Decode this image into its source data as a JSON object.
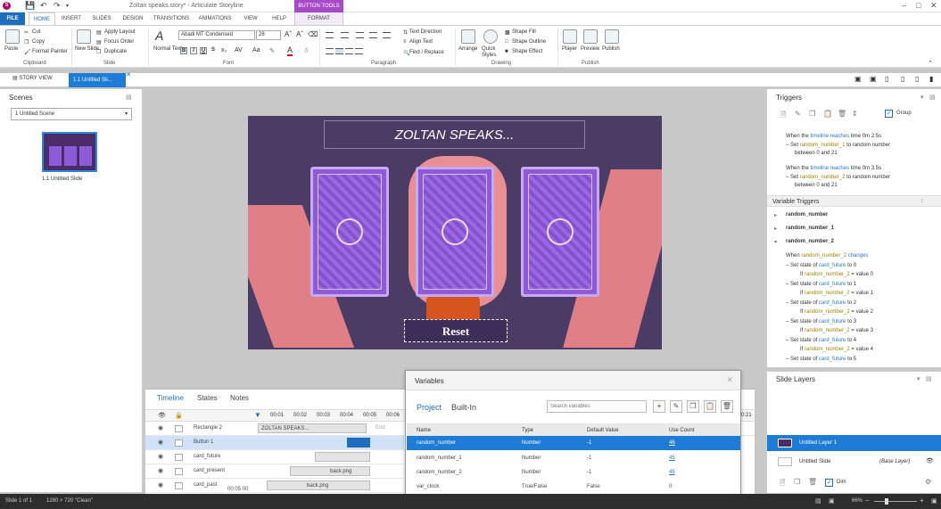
{
  "app": {
    "title": "Zoltan speaks.story* - Articulate Storyline",
    "contextual_tab": "BUTTON TOOLS"
  },
  "tabs": [
    "FILE",
    "HOME",
    "INSERT",
    "SLIDES",
    "DESIGN",
    "TRANSITIONS",
    "ANIMATIONS",
    "VIEW",
    "HELP",
    "FORMAT"
  ],
  "ribbon": {
    "clipboard": {
      "paste": "Paste",
      "cut": "Cut",
      "copy": "Copy",
      "format_painter": "Format Painter",
      "label": "Clipboard"
    },
    "slide": {
      "new_slide": "New Slide",
      "apply_layout": "Apply Layout",
      "focus_order": "Focus Order",
      "duplicate": "Duplicate",
      "label": "Slide"
    },
    "text": {
      "normal_text": "Normal Text"
    },
    "font": {
      "family": "Abadi MT Condensed",
      "size": "28",
      "label": "Font"
    },
    "paragraph": {
      "text_direction": "Text Direction",
      "align_text": "Align Text",
      "find_replace": "Find / Replace",
      "label": "Paragraph"
    },
    "drawing": {
      "arrange": "Arrange",
      "quick_styles": "Quick Styles",
      "shape_fill": "Shape Fill",
      "shape_outline": "Shape Outline",
      "shape_effect": "Shape Effect",
      "label": "Drawing"
    },
    "publish": {
      "player": "Player",
      "preview": "Preview",
      "publish": "Publish",
      "label": "Publish"
    }
  },
  "view_tabs": {
    "story_view": "STORY VIEW",
    "slide_tab": "1.1 Untitled Sli..."
  },
  "scenes": {
    "title": "Scenes",
    "selected": "1 Untitled Scene",
    "slide_label": "1.1 Untitled Slide"
  },
  "slide": {
    "title": "ZOLTAN SPEAKS...",
    "reset_label": "Reset"
  },
  "timeline": {
    "tabs": {
      "timeline": "Timeline",
      "states": "States",
      "notes": "Notes"
    },
    "ticks": [
      "00:01",
      "00:02",
      "00:03",
      "00:04",
      "00:05",
      "00:06"
    ],
    "end_label": "End",
    "rows": [
      {
        "name": "Rectangle 2",
        "bar": "ZOLTAN SPEAKS..."
      },
      {
        "name": "Button 1",
        "bar": ""
      },
      {
        "name": "card_future",
        "bar": ""
      },
      {
        "name": "card_present",
        "bar": "back.png"
      },
      {
        "name": "card_past",
        "bar": "back.png"
      }
    ],
    "time": "00:05.00",
    "right_time": "0:21"
  },
  "triggers": {
    "title": "Triggers",
    "group_label": "Group",
    "t1_when": "When the",
    "t1_kw": "timeline reaches",
    "t1_rest": "time 0m 2.5s",
    "t1_set": "Set",
    "t1_var": "random_number_1",
    "t1_to": "to random number",
    "t1_range": "between 0 and 21",
    "t2_when": "When the",
    "t2_kw": "timeline reaches",
    "t2_rest": "time 0m 3.5s",
    "t2_set": "Set",
    "t2_var": "random_number_2",
    "t2_to": "to random number",
    "t2_range": "between 0 and 21",
    "variable_triggers": "Variable Triggers",
    "vars": [
      "random_number",
      "random_number_1",
      "random_number_2"
    ],
    "when_changes_pre": "When",
    "when_changes_var": "random_number_2",
    "when_changes_kw": "changes",
    "states": [
      {
        "state": "0",
        "value": "value 0"
      },
      {
        "state": "1",
        "value": "value 1"
      },
      {
        "state": "2",
        "value": "value 2"
      },
      {
        "state": "3",
        "value": "value 3"
      },
      {
        "state": "4",
        "value": "value 4"
      },
      {
        "state": "5",
        "value": ""
      }
    ],
    "set_state_of": "Set state of",
    "card_future": "card_future",
    "to": "to",
    "if": "If",
    "eq": "="
  },
  "layers": {
    "title": "Slide Layers",
    "layer1": "Untitled Layer 1",
    "base": "Untitled Slide",
    "base_tag": "(Base Layer)",
    "dim": "Dim"
  },
  "variables": {
    "title": "Variables",
    "tab_project": "Project",
    "tab_builtin": "Built-In",
    "search_placeholder": "Search variables",
    "headers": {
      "name": "Name",
      "type": "Type",
      "default": "Default Value",
      "use": "Use Count"
    },
    "rows": [
      {
        "name": "random_number",
        "type": "Number",
        "default": "-1",
        "use": "46"
      },
      {
        "name": "random_number_1",
        "type": "Number",
        "default": "-1",
        "use": "45"
      },
      {
        "name": "random_number_2",
        "type": "Number",
        "default": "-1",
        "use": "45"
      },
      {
        "name": "var_clock",
        "type": "True/False",
        "default": "False",
        "use": "0"
      }
    ]
  },
  "status": {
    "slide": "Slide 1 of 1",
    "size": "1280 × 720",
    "theme": "\"Clean\"",
    "zoom": "66%"
  }
}
